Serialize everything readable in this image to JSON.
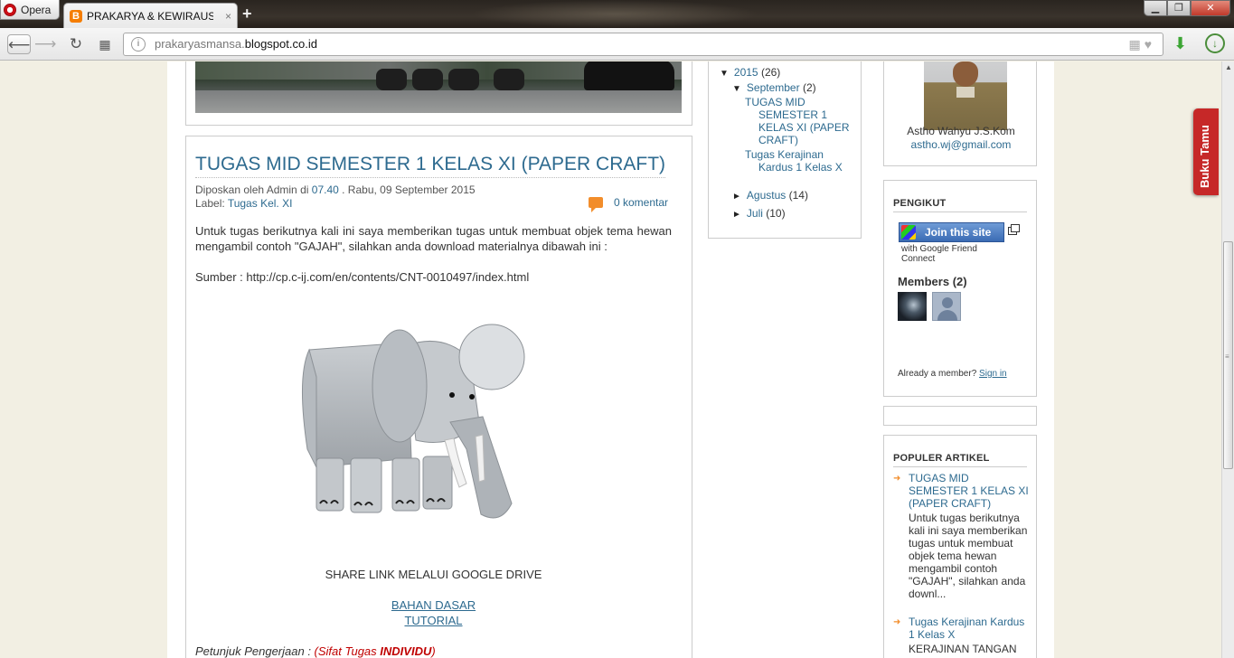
{
  "browser": {
    "opera_label": "Opera",
    "tab_title": "PRAKARYA & KEWIRAUSA",
    "tab_close": "×",
    "new_tab": "+",
    "url_prefix": "prakaryasmansa.",
    "url_domain": "blogspot.co.id",
    "favicon_letter": "B",
    "win_min": "▁",
    "win_max": "❐",
    "win_close": "✕"
  },
  "post": {
    "title": "TUGAS MID SEMESTER 1 KELAS XI (PAPER CRAFT)",
    "posted_by_prefix": "Diposkan oleh Admin di",
    "time": "07.40",
    "date_suffix": ". Rabu, 09 September 2015",
    "label_prefix": "Label:",
    "label": "Tugas Kel. XI",
    "comments": "0 komentar",
    "paragraph": "Untuk tugas berikutnya kali ini saya memberikan tugas untuk membuat objek tema hewan mengambil contoh \"GAJAH\", silahkan anda download materialnya dibawah ini :",
    "source": "Sumber : http://cp.c-ij.com/en/contents/CNT-0010497/index.html",
    "share_text": "SHARE LINK MELALUI GOOGLE DRIVE",
    "link_bahan": "BAHAN DASAR",
    "link_tutorial": "TUTORIAL",
    "petunjuk_prefix": "Petunjuk Pengerjaan : ",
    "petunjuk_paren_open": "(Sifat Tugas ",
    "petunjuk_bold": "INDIVIDU",
    "petunjuk_paren_close": ")"
  },
  "archive": {
    "year": "2015",
    "year_count": "(26)",
    "month1": "September",
    "month1_count": "(2)",
    "post1": "TUGAS MID SEMESTER 1 KELAS XI (PAPER CRAFT)",
    "post2": "Tugas Kerajinan Kardus 1 Kelas X",
    "month2": "Agustus",
    "month2_count": "(14)",
    "month3": "Juli",
    "month3_count": "(10)"
  },
  "profile": {
    "name": "Astho Wahyu J.S.Kom",
    "email": "astho.wj@gmail.com"
  },
  "followers": {
    "heading": "PENGIKUT",
    "join_button": "Join this site",
    "gfc_text": "with Google Friend Connect",
    "members_title": "Members (2)",
    "already_text": "Already a member?",
    "sign_in": "Sign in"
  },
  "popular": {
    "heading": "POPULER ARTIKEL",
    "items": [
      {
        "title": "TUGAS MID SEMESTER 1 KELAS XI (PAPER CRAFT)",
        "snippet": "Untuk tugas berikutnya kali ini saya memberikan tugas untuk membuat objek tema hewan mengambil contoh \"GAJAH\", silahkan anda downl..."
      },
      {
        "title": "Tugas Kerajinan Kardus 1 Kelas X",
        "snippet": "KERAJINAN TANGAN"
      }
    ]
  },
  "guestbook": {
    "label": "Buku Tamu"
  },
  "colors": {
    "link": "#2d6a8f",
    "guestbook_tab": "#c62828",
    "page_background": "#f2efe3",
    "accent_orange": "#f28d2b"
  }
}
